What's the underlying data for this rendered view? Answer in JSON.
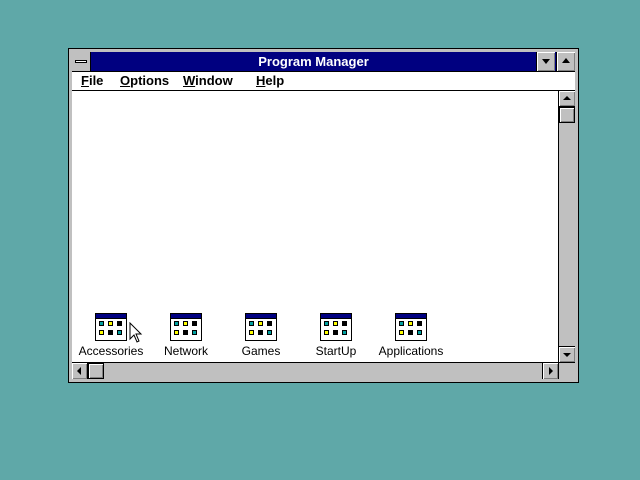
{
  "window": {
    "title": "Program Manager"
  },
  "menubar": {
    "items": [
      {
        "label": "File",
        "accel": "F",
        "rest": "ile"
      },
      {
        "label": "Options",
        "accel": "O",
        "rest": "ptions"
      },
      {
        "label": "Window",
        "accel": "W",
        "rest": "indow"
      },
      {
        "label": "Help",
        "accel": "H",
        "rest": "elp"
      }
    ]
  },
  "groups": [
    {
      "label": "Accessories"
    },
    {
      "label": "Network"
    },
    {
      "label": "Games"
    },
    {
      "label": "StartUp"
    },
    {
      "label": "Applications"
    }
  ],
  "icons": {
    "system_menu": "system-menu-icon",
    "minimize": "minimize-icon",
    "maximize": "maximize-icon",
    "group": "program-group-icon",
    "cursor": "mouse-pointer-icon"
  },
  "colors": {
    "desktop": "#5fa8a8",
    "titlebar": "#000080",
    "chrome": "#c0c0c0"
  }
}
